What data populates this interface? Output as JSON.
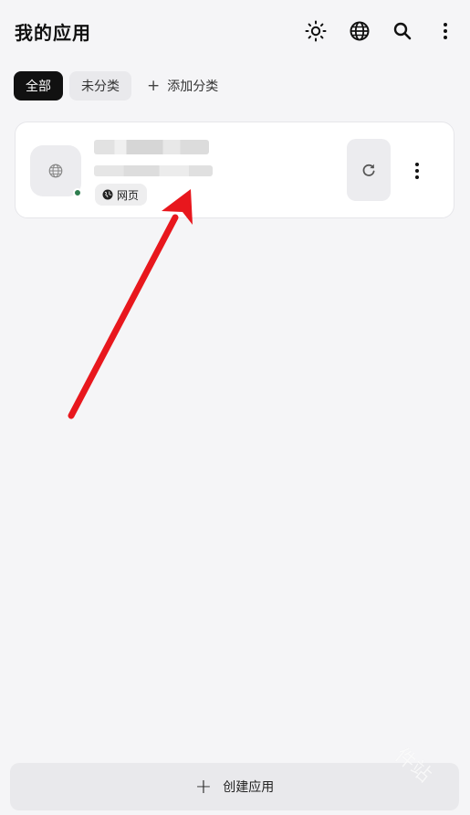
{
  "header": {
    "title": "我的应用",
    "icons": [
      "theme-sun-icon",
      "language-globe-icon",
      "search-icon",
      "more-vertical-icon"
    ]
  },
  "tabs": {
    "all": "全部",
    "uncategorized": "未分类",
    "add_category": "添加分类"
  },
  "app_card": {
    "status": "online",
    "status_color": "#2e7d4f",
    "type_label": "网页",
    "icons": [
      "web-app-icon",
      "refresh-icon",
      "more-vertical-icon"
    ]
  },
  "footer": {
    "create_label": "创建应用"
  },
  "watermark": "件站",
  "colors": {
    "accent": "#111111",
    "background": "#f5f5f7",
    "arrow": "#e8171d"
  }
}
